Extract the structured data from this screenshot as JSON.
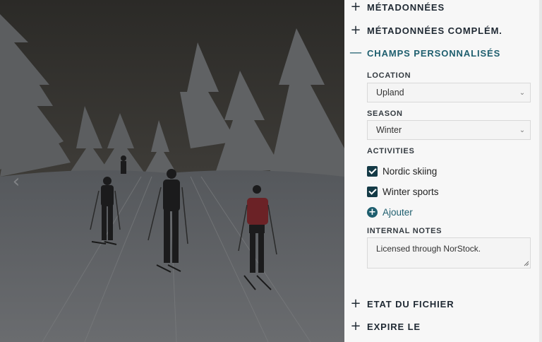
{
  "viewer": {
    "prev_glyph": "‹",
    "image_subject": "cross-country skiers on a snowy forest trail"
  },
  "panel": {
    "sections": [
      {
        "toggle": "+",
        "title": "MÉTADONNÉES"
      },
      {
        "toggle": "+",
        "title": "MÉTADONNÉES COMPLÉM."
      },
      {
        "toggle": "—",
        "title": "CHAMPS PERSONNALISÉS"
      },
      {
        "toggle": "+",
        "title": "ETAT DU FICHIER"
      },
      {
        "toggle": "+",
        "title": "EXPIRE LE"
      }
    ],
    "custom_fields": {
      "location": {
        "label": "LOCATION",
        "value": "Upland"
      },
      "season": {
        "label": "SEASON",
        "value": "Winter"
      },
      "activities": {
        "label": "ACTIVITIES",
        "items": [
          {
            "label": "Nordic skiing",
            "checked": true
          },
          {
            "label": "Winter sports",
            "checked": true
          }
        ],
        "add_label": "Ajouter"
      },
      "internal_notes": {
        "label": "INTERNAL NOTES",
        "value": "Licensed through NorStock."
      }
    }
  },
  "colors": {
    "accent": "#1e5e6e",
    "checkbox": "#143a46",
    "panel_bg": "#f7f7f7"
  }
}
